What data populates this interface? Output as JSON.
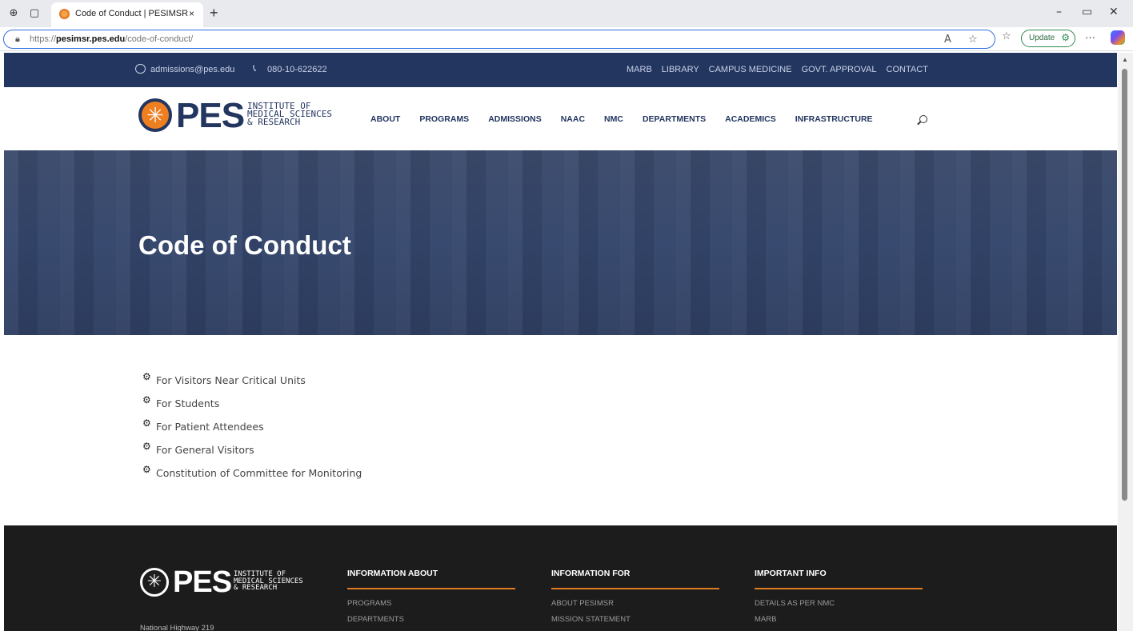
{
  "browser": {
    "tab_title": "Code of Conduct | PESIMSR",
    "tab_close": "×",
    "new_tab": "+",
    "url_scheme": "https://",
    "url_domain": "pesimsr.pes.edu",
    "url_path": "/code-of-conduct/",
    "update_label": "Update",
    "more_label": "···"
  },
  "topbar": {
    "email": "admissions@pes.edu",
    "phone": "080-10-622622",
    "links": [
      "MARB",
      "LIBRARY",
      "CAMPUS MEDICINE",
      "GOVT. APPROVAL",
      "CONTACT"
    ]
  },
  "logo": {
    "wordmark": "PES",
    "line1": "INSTITUTE OF",
    "line2": "MEDICAL SCIENCES",
    "line3": "& RESEARCH"
  },
  "nav": {
    "items": [
      "ABOUT",
      "PROGRAMS",
      "ADMISSIONS",
      "NAAC",
      "NMC",
      "DEPARTMENTS",
      "ACADEMICS",
      "INFRASTRUCTURE"
    ]
  },
  "hero": {
    "title": "Code of Conduct"
  },
  "conduct_links": [
    "For Visitors Near Critical Units",
    "For Students",
    "For Patient Attendees",
    "For General Visitors",
    "Constitution of Committee for Monitoring"
  ],
  "footer": {
    "address": "National Highway 219",
    "columns": [
      {
        "heading": "INFORMATION ABOUT",
        "links": [
          "PROGRAMS",
          "DEPARTMENTS"
        ]
      },
      {
        "heading": "INFORMATION FOR",
        "links": [
          "ABOUT PESIMSR",
          "MISSION STATEMENT"
        ]
      },
      {
        "heading": "IMPORTANT INFO",
        "links": [
          "DETAILS AS PER NMC",
          "MARB"
        ]
      }
    ]
  },
  "colors": {
    "brand_navy": "#233660",
    "brand_orange": "#ee7f21",
    "footer_bg": "#1c1c1c"
  }
}
